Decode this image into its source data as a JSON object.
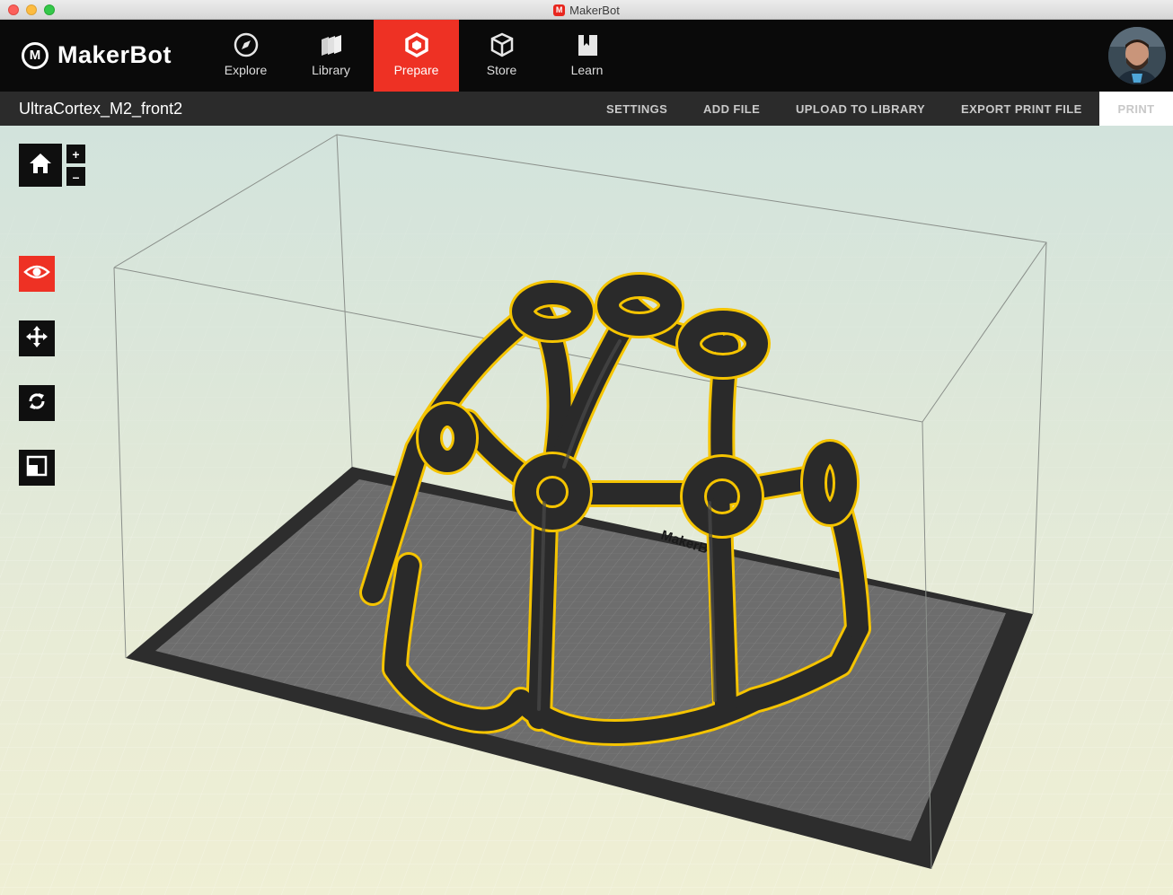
{
  "window": {
    "title": "MakerBot"
  },
  "nav": {
    "logo_text": "MakerBot",
    "logo_mark": "M",
    "tabs": [
      {
        "label": "Explore",
        "icon": "compass-icon"
      },
      {
        "label": "Library",
        "icon": "library-stack-icon"
      },
      {
        "label": "Prepare",
        "icon": "prepare-cube-icon",
        "active": true
      },
      {
        "label": "Store",
        "icon": "store-box-icon"
      },
      {
        "label": "Learn",
        "icon": "book-icon"
      }
    ]
  },
  "toolbar": {
    "file_name": "UltraCortex_M2_front2",
    "settings": "SETTINGS",
    "add_file": "ADD FILE",
    "upload": "UPLOAD TO LIBRARY",
    "export": "EXPORT PRINT FILE",
    "print": "PRINT"
  },
  "zoom": {
    "plus": "+",
    "minus": "–"
  },
  "plate_brand": "MakerBot",
  "colors": {
    "accent": "#ee3124",
    "nav_bg": "#0a0a0a",
    "toolbar_bg": "#2b2b2b",
    "model": "#2a2a2a",
    "model_outline": "#f5c400",
    "plate": "#6e6e6e"
  }
}
